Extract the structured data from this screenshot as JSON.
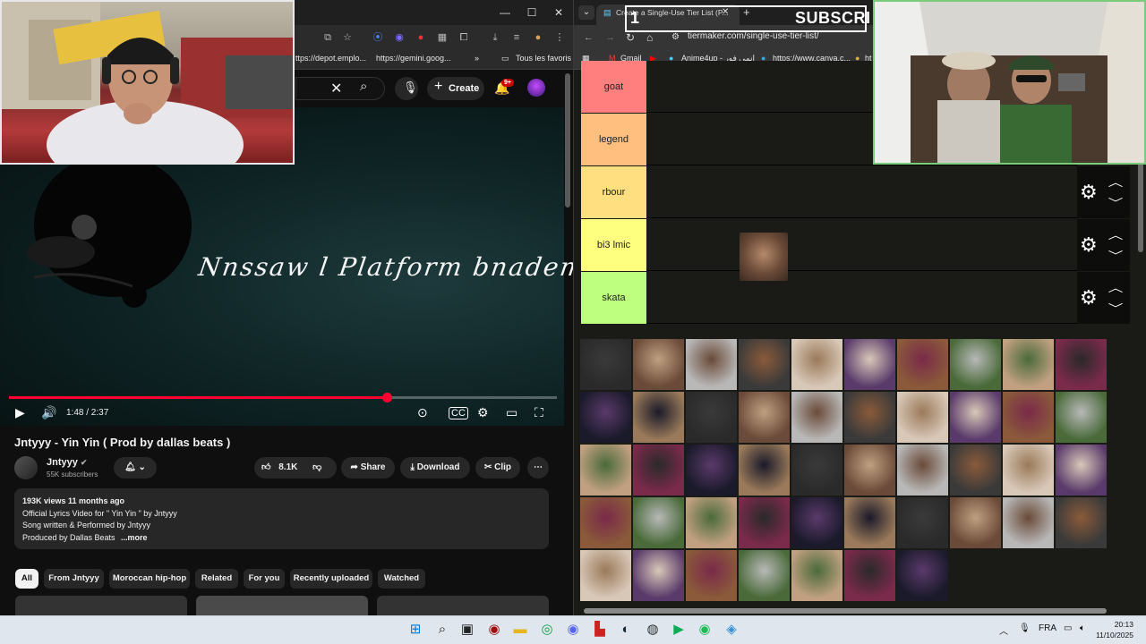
{
  "left_browser": {
    "bookmarks": [
      "ttps://depot.emplo...",
      "https://gemini.goog...",
      "Tous les favoris"
    ],
    "youtube": {
      "create_label": "Create",
      "notification_count": "9+",
      "video": {
        "overlay_title": "Nnssaw l Platform bnadem Fegar",
        "current_time": "1:48 / 2:37",
        "progress": 0.69,
        "title": "Jntyyy - Yin Yin ( Prod by dallas beats )"
      },
      "channel": {
        "name": "Jntyyy",
        "subscribers": "55K subscribers"
      },
      "actions": {
        "likes": "8.1K",
        "share": "Share",
        "download": "Download",
        "clip": "Clip"
      },
      "description": {
        "stats": "193K views  11 months ago",
        "line1": "Official Lyrics Video for \" Yin Yin \" by Jntyyy",
        "line2": "Song written & Performed by Jntyyy",
        "line3": "Produced by Dallas Beats",
        "more": "...more"
      },
      "chips": [
        "All",
        "From Jntyyy",
        "Moroccan hip-hop",
        "Related",
        "For you",
        "Recently uploaded",
        "Watched"
      ]
    }
  },
  "right_browser": {
    "tab_title": "Create a Single-Use Tier List (P...",
    "url": "tiermaker.com/single-use-tier-list/",
    "bookmarks": [
      "Gmail",
      "Anime4up - انمي فور",
      "https://www.canva.c...",
      "ht"
    ],
    "overlay": {
      "subscribe": "SUBSCRI",
      "number": "1"
    },
    "tiers": [
      {
        "label": "goat",
        "color": "#ff7f7f"
      },
      {
        "label": "legend",
        "color": "#ffbf7f"
      },
      {
        "label": "rbour",
        "color": "#ffdf7f"
      },
      {
        "label": "bi3 lmic",
        "color": "#ffff7f"
      },
      {
        "label": "skata",
        "color": "#bfff7f"
      }
    ],
    "pool_count": 47
  },
  "taskbar": {
    "language": "FRA",
    "time": "20:13",
    "date": "11/10/2025"
  }
}
